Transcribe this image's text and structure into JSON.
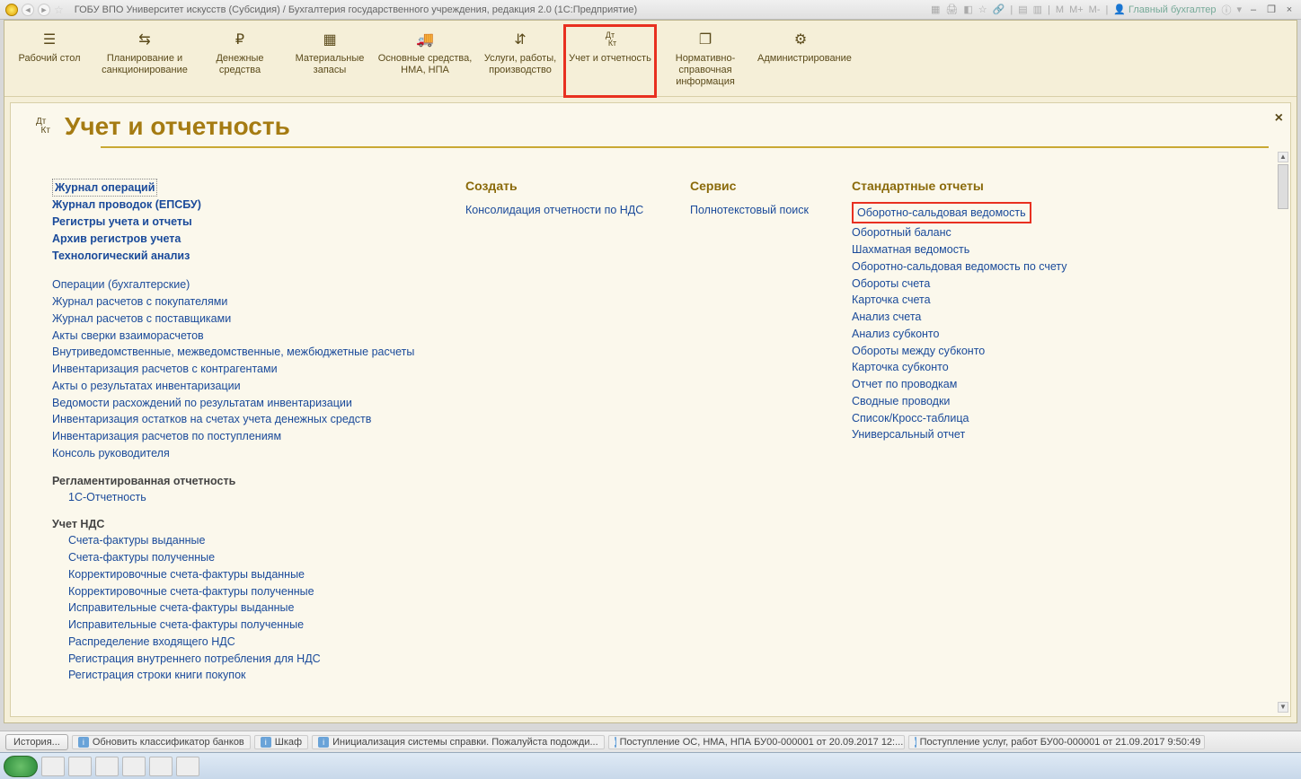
{
  "titlebar": {
    "title": "ГОБУ ВПО Университет искусств (Субсидия) / Бухгалтерия государственного учреждения, редакция 2.0  (1С:Предприятие)",
    "mem_m": "M",
    "mem_mp": "M+",
    "mem_mm": "M-",
    "user": "Главный бухгалтер",
    "info_icon": "ⓘ",
    "min": "–",
    "max": "❐",
    "close": "×"
  },
  "nav": [
    {
      "icon": "☰",
      "label": "Рабочий стол"
    },
    {
      "icon": "⇆",
      "label": "Планирование и санкционирование"
    },
    {
      "icon": "₽",
      "label": "Денежные средства"
    },
    {
      "icon": "▦",
      "label": "Материальные запасы"
    },
    {
      "icon": "🚚",
      "label": "Основные средства, НМА, НПА"
    },
    {
      "icon": "⇵",
      "label": "Услуги, работы, производство"
    },
    {
      "icon": "Дт Кт",
      "label": "Учет и отчетность",
      "highlighted": true
    },
    {
      "icon": "❐",
      "label": "Нормативно-справочная информация"
    },
    {
      "icon": "⚙",
      "label": "Администрирование"
    }
  ],
  "panel": {
    "icon": "Дт Кт",
    "title": "Учет и отчетность",
    "close": "×"
  },
  "col1": {
    "top_links": [
      {
        "t": "Журнал операций",
        "bold": true,
        "dotted": true
      },
      {
        "t": "Журнал проводок (ЕПСБУ)",
        "bold": true
      },
      {
        "t": "Регистры учета и отчеты",
        "bold": true
      },
      {
        "t": "Архив регистров учета",
        "bold": true
      },
      {
        "t": "Технологический анализ",
        "bold": true
      }
    ],
    "ops_links": [
      "Операции (бухгалтерские)",
      "Журнал расчетов с покупателями",
      "Журнал расчетов с поставщиками",
      "Акты сверки взаиморасчетов",
      "Внутриведомственные, межведомственные, межбюджетные расчеты",
      "Инвентаризация расчетов с контрагентами",
      "Акты о результатах инвентаризации",
      "Ведомости расхождений по результатам инвентаризации",
      "Инвентаризация остатков на счетах учета денежных средств",
      "Инвентаризация расчетов по поступлениям",
      "Консоль руководителя"
    ],
    "regl_head": "Регламентированная отчетность",
    "regl_links": [
      "1С-Отчетность"
    ],
    "nds_head": "Учет НДС",
    "nds_links": [
      "Счета-фактуры выданные",
      "Счета-фактуры полученные",
      "Корректировочные счета-фактуры выданные",
      "Корректировочные счета-фактуры полученные",
      "Исправительные счета-фактуры выданные",
      "Исправительные счета-фактуры полученные",
      "Распределение входящего НДС",
      "Регистрация внутреннего потребления для НДС",
      "Регистрация строки книги покупок"
    ]
  },
  "col2": {
    "head": "Создать",
    "links": [
      "Консолидация отчетности по НДС"
    ]
  },
  "col3": {
    "head": "Сервис",
    "links": [
      "Полнотекстовый поиск"
    ]
  },
  "col4": {
    "head": "Стандартные отчеты",
    "links": [
      {
        "t": "Оборотно-сальдовая ведомость",
        "boxed": true
      },
      {
        "t": "Оборотный баланс"
      },
      {
        "t": "Шахматная ведомость"
      },
      {
        "t": "Оборотно-сальдовая ведомость по счету"
      },
      {
        "t": "Обороты счета"
      },
      {
        "t": "Карточка счета"
      },
      {
        "t": "Анализ счета"
      },
      {
        "t": "Анализ субконто"
      },
      {
        "t": "Обороты между субконто"
      },
      {
        "t": "Карточка субконто"
      },
      {
        "t": "Отчет по проводкам"
      },
      {
        "t": "Сводные проводки"
      },
      {
        "t": "Список/Кросс-таблица"
      },
      {
        "t": "Универсальный отчет"
      }
    ]
  },
  "statusbar": {
    "history": "История...",
    "items": [
      "Обновить классификатор банков",
      "Шкаф",
      "Инициализация системы справки. Пожалуйста подожди...",
      "Поступление ОС, НМА, НПА БУ00-000001 от 20.09.2017 12:...",
      "Поступление услуг, работ БУ00-000001 от 21.09.2017 9:50:49"
    ]
  }
}
